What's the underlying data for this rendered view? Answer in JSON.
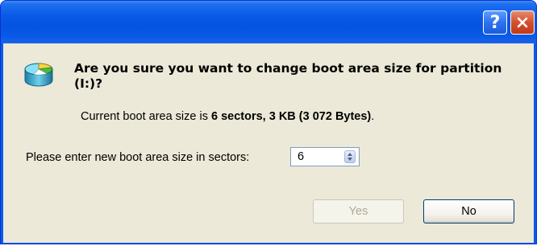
{
  "title_bar": {
    "help_label": "?",
    "close_icon": "close-icon"
  },
  "dialog": {
    "icon": "disk-partition-icon",
    "question": "Are you sure you want to change boot area size for partition (I:)?",
    "info_prefix": "Current boot area size is ",
    "info_value": "6 sectors, 3 KB (3 072 Bytes)",
    "info_suffix": ".",
    "prompt_label": "Please enter new boot area size in sectors:",
    "sectors_value": "6",
    "yes_label": "Yes",
    "yes_enabled": false,
    "no_label": "No"
  },
  "colors": {
    "titlebar": "#0a5ae8",
    "client_background": "#ece9d8",
    "close_button": "#c0391a",
    "disabled_text": "#aca899"
  }
}
